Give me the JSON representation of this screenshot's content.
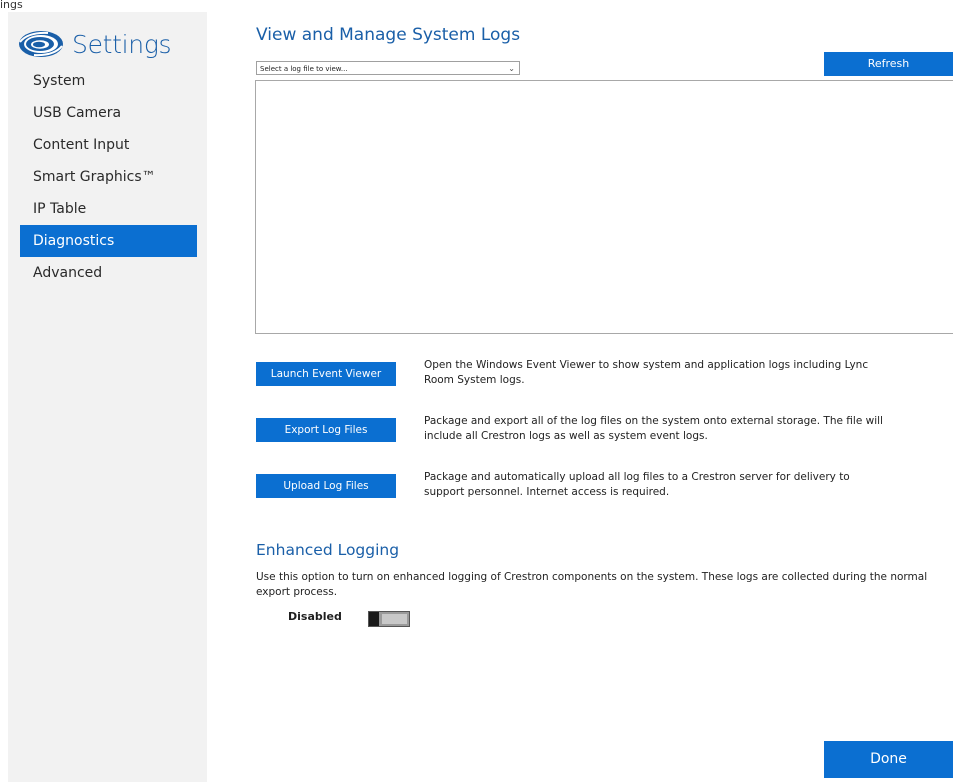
{
  "window": {
    "corner_text": "ings"
  },
  "sidebar": {
    "app_title": "Settings",
    "logo_icon": "crestron-swirl-icon",
    "items": [
      {
        "label": "System",
        "active": false
      },
      {
        "label": "USB Camera",
        "active": false
      },
      {
        "label": "Content Input",
        "active": false
      },
      {
        "label": "Smart Graphics™",
        "active": false
      },
      {
        "label": "IP Table",
        "active": false
      },
      {
        "label": "Diagnostics",
        "active": true
      },
      {
        "label": "Advanced",
        "active": false
      }
    ]
  },
  "main": {
    "title": "View and Manage System Logs",
    "log_select": {
      "value": "Select a log file to view...",
      "chevron_icon": "chevron-down-icon"
    },
    "refresh_label": "Refresh",
    "actions": [
      {
        "button": "Launch Event Viewer",
        "description": "Open the Windows Event Viewer to show system and application logs including Lync Room System logs."
      },
      {
        "button": "Export Log Files",
        "description": "Package and export all of the log files on the system onto external storage.  The file will include all Crestron logs as well as system event logs."
      },
      {
        "button": "Upload Log Files",
        "description": "Package and automatically upload all log files to a Crestron server for delivery to support personnel.  Internet access is required."
      }
    ],
    "enhanced_logging": {
      "title": "Enhanced Logging",
      "description": "Use this option to turn on enhanced logging of Crestron components on the system.  These logs are collected during the normal export process.",
      "state_label": "Disabled",
      "enabled": false
    },
    "done_label": "Done"
  },
  "colors": {
    "accent": "#0b6fd1",
    "title": "#1a5fa8",
    "sidebar_bg": "#f2f2f2"
  }
}
